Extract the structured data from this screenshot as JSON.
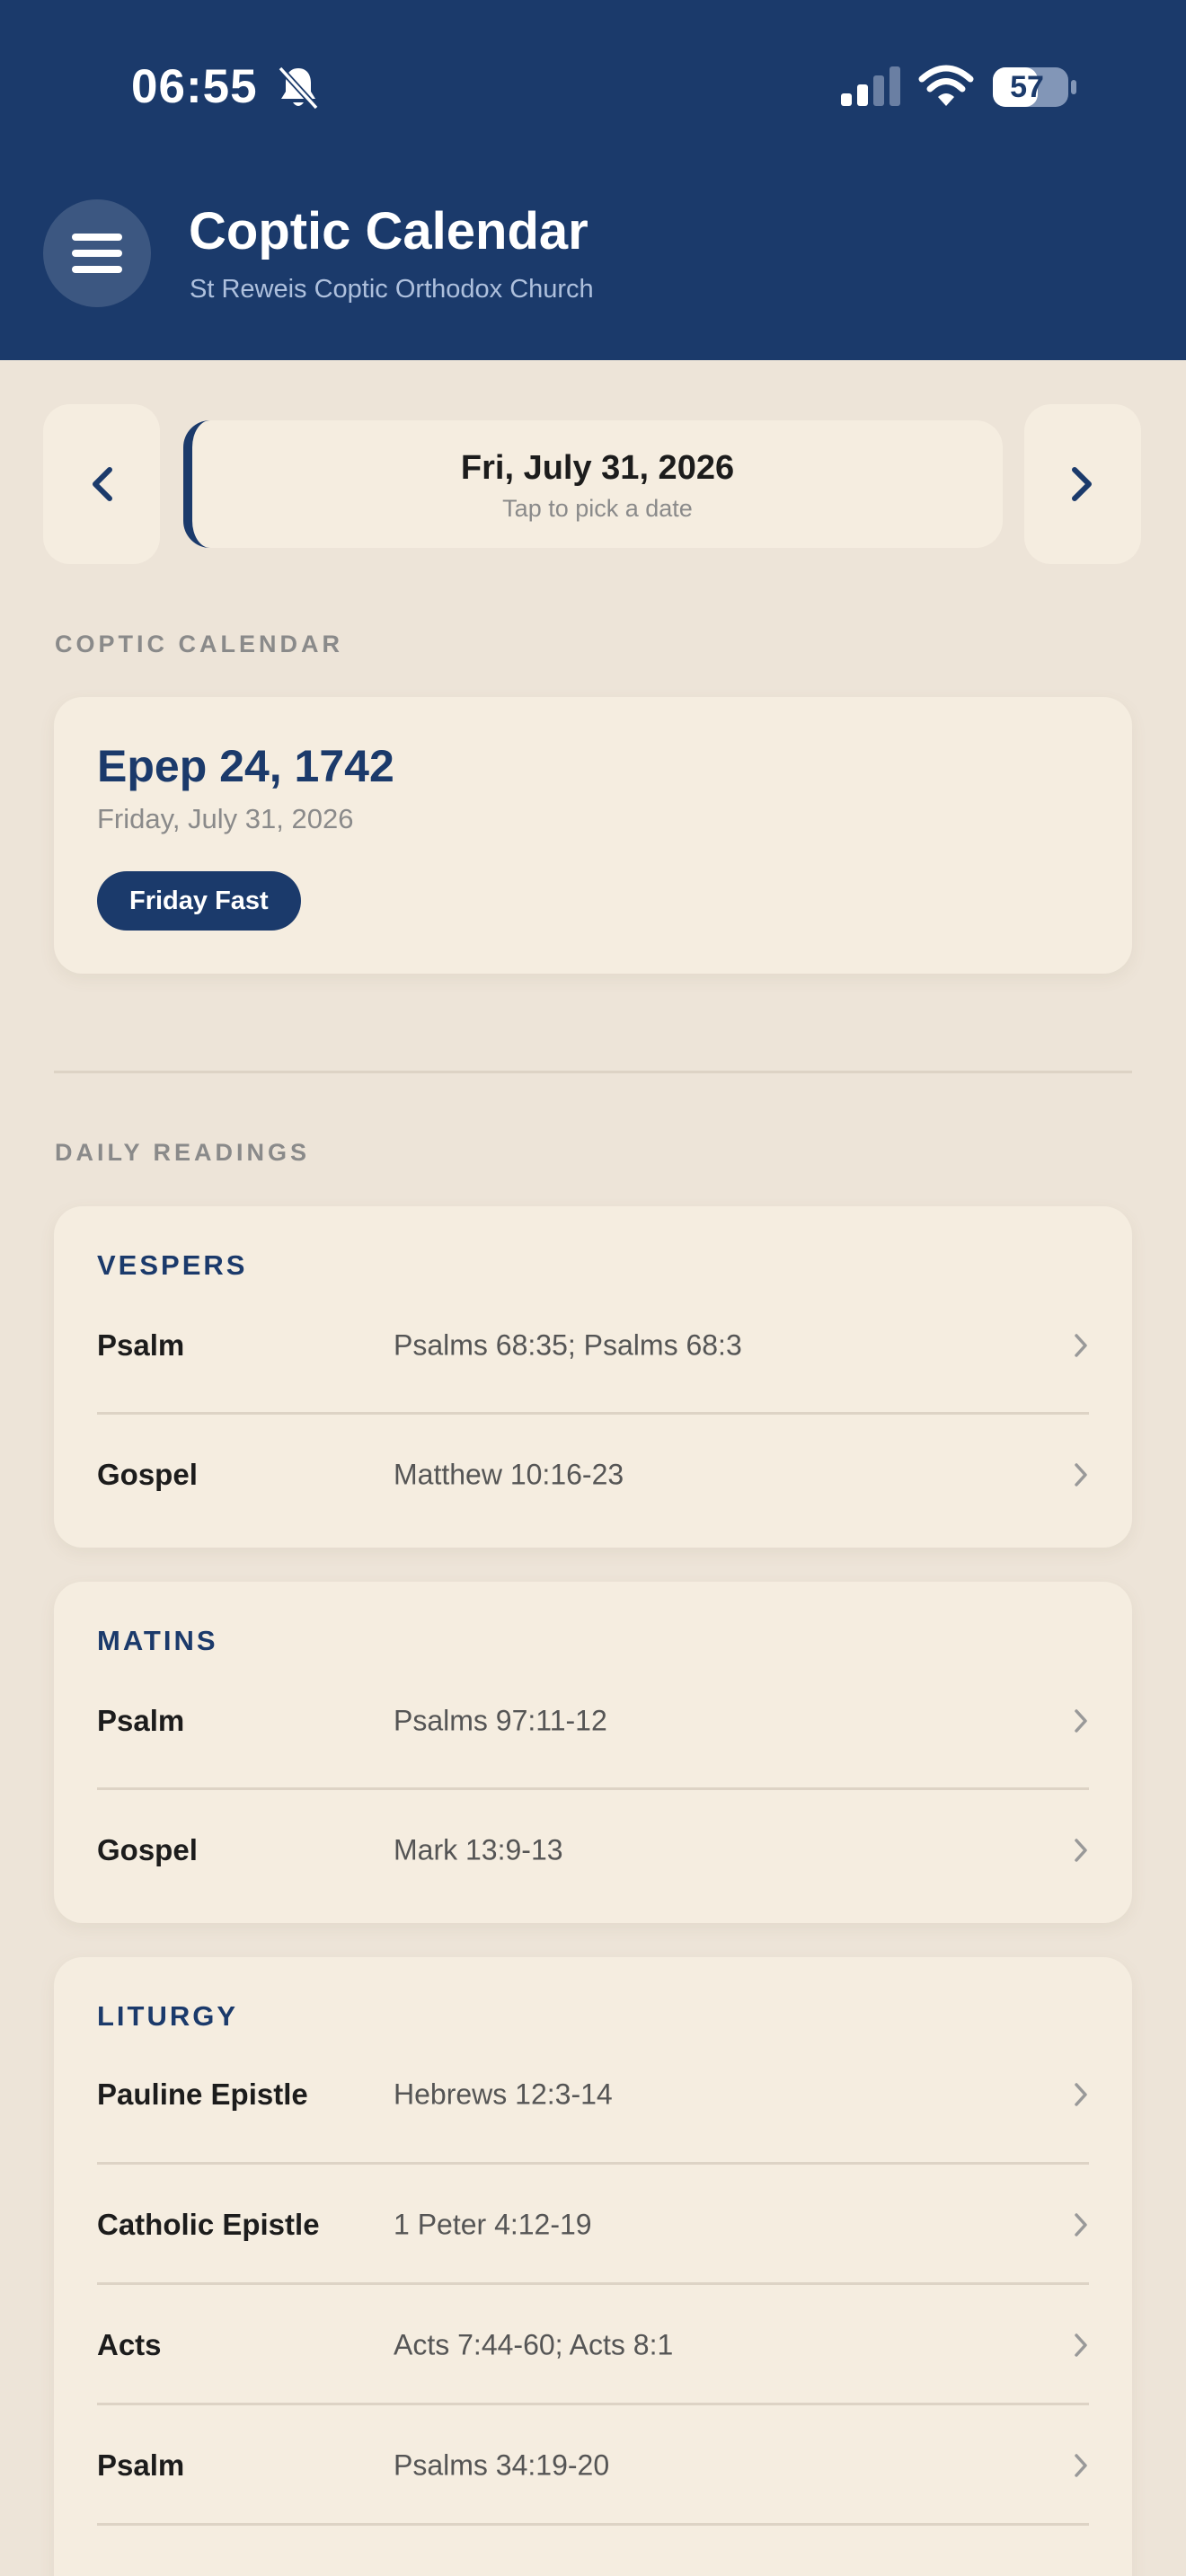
{
  "status_bar": {
    "time": "06:55",
    "battery": "57",
    "icons": [
      "bell-slash-icon",
      "cellular-signal-icon",
      "wifi-icon",
      "battery-icon"
    ]
  },
  "header": {
    "title": "Coptic Calendar",
    "subtitle": "St Reweis Coptic Orthodox Church",
    "menu_icon": "hamburger-menu-icon"
  },
  "date_nav": {
    "prev_icon": "chevron-left-icon",
    "next_icon": "chevron-right-icon",
    "selected_date": "Fri, July 31, 2026",
    "hint": "Tap to pick a date"
  },
  "coptic_section": {
    "label": "COPTIC CALENDAR",
    "coptic_date": "Epep 24, 1742",
    "gregorian_date": "Friday, July 31, 2026",
    "badge": "Friday Fast"
  },
  "readings_section": {
    "label": "DAILY READINGS",
    "groups": [
      {
        "title": "VESPERS",
        "items": [
          {
            "label": "Psalm",
            "ref": "Psalms 68:35; Psalms 68:3"
          },
          {
            "label": "Gospel",
            "ref": "Matthew 10:16-23"
          }
        ]
      },
      {
        "title": "MATINS",
        "items": [
          {
            "label": "Psalm",
            "ref": "Psalms 97:11-12"
          },
          {
            "label": "Gospel",
            "ref": "Mark 13:9-13"
          }
        ]
      },
      {
        "title": "LITURGY",
        "items": [
          {
            "label": "Pauline Epistle",
            "ref": "Hebrews 12:3-14"
          },
          {
            "label": "Catholic Epistle",
            "ref": "1 Peter 4:12-19"
          },
          {
            "label": "Acts",
            "ref": "Acts 7:44-60; Acts 8:1"
          },
          {
            "label": "Psalm",
            "ref": "Psalms 34:19-20"
          }
        ]
      }
    ]
  },
  "colors": {
    "primary": "#1B3A6B",
    "background": "#EDE4D8",
    "card": "#F5EDE0"
  }
}
